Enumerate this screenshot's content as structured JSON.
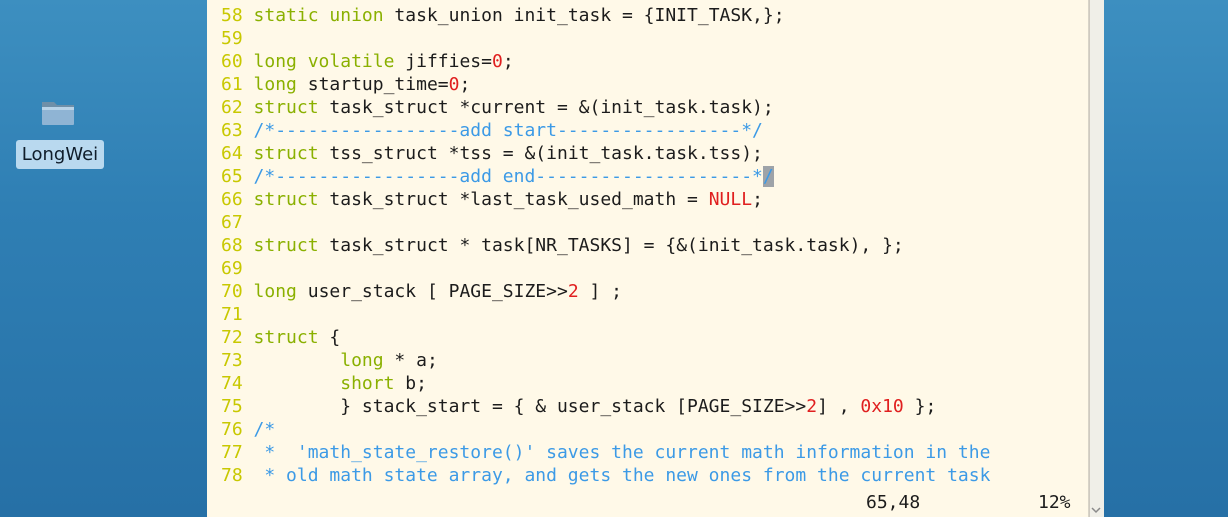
{
  "desktop": {
    "icon_name": "folder-icon",
    "label": "LongWei"
  },
  "editor": {
    "colors": {
      "background": "#fff9e8",
      "line_number": "#c8c800",
      "keyword": "#8ab000",
      "number": "#e01f1f",
      "comment": "#3c9ae6"
    },
    "lines": [
      {
        "n": "58",
        "t": [
          [
            "kw",
            "static union"
          ],
          [
            "",
            "task_union init_task = {INIT_TASK,};"
          ]
        ]
      },
      {
        "n": "59",
        "t": []
      },
      {
        "n": "60",
        "t": [
          [
            "kw",
            "long volatile"
          ],
          [
            "",
            "jiffies="
          ],
          [
            "num",
            "0"
          ],
          [
            "",
            ";"
          ]
        ]
      },
      {
        "n": "61",
        "t": [
          [
            "kw",
            "long"
          ],
          [
            "",
            "startup_time="
          ],
          [
            "num",
            "0"
          ],
          [
            "",
            ";"
          ]
        ]
      },
      {
        "n": "62",
        "t": [
          [
            "kw",
            "struct"
          ],
          [
            "",
            "task_struct *current = &(init_task.task);"
          ]
        ]
      },
      {
        "n": "63",
        "t": [
          [
            "cmt",
            "/*-----------------add start-----------------*/"
          ]
        ]
      },
      {
        "n": "64",
        "t": [
          [
            "kw",
            "struct"
          ],
          [
            "",
            "tss_struct *tss = &(init_task.task.tss);"
          ]
        ]
      },
      {
        "n": "65",
        "t": [
          [
            "cmt",
            "/*-----------------add end--------------------*"
          ],
          [
            "cursor",
            "/"
          ]
        ]
      },
      {
        "n": "66",
        "t": [
          [
            "kw",
            "struct"
          ],
          [
            "",
            "task_struct *last_task_used_math = "
          ],
          [
            "num",
            "NULL"
          ],
          [
            "",
            ";"
          ]
        ]
      },
      {
        "n": "67",
        "t": []
      },
      {
        "n": "68",
        "t": [
          [
            "kw",
            "struct"
          ],
          [
            "",
            "task_struct * task[NR_TASKS] = {&(init_task.task), };"
          ]
        ]
      },
      {
        "n": "69",
        "t": []
      },
      {
        "n": "70",
        "t": [
          [
            "kw",
            "long"
          ],
          [
            "",
            "user_stack [ PAGE_SIZE>>"
          ],
          [
            "num",
            "2"
          ],
          [
            "",
            " ] ;"
          ]
        ]
      },
      {
        "n": "71",
        "t": []
      },
      {
        "n": "72",
        "t": [
          [
            "kw",
            "struct"
          ],
          [
            "",
            " {"
          ]
        ]
      },
      {
        "n": "73",
        "t": [
          [
            "",
            "        "
          ],
          [
            "kw",
            "long"
          ],
          [
            "",
            " * a;"
          ]
        ]
      },
      {
        "n": "74",
        "t": [
          [
            "",
            "        "
          ],
          [
            "kw",
            "short"
          ],
          [
            "",
            " b;"
          ]
        ]
      },
      {
        "n": "75",
        "t": [
          [
            "",
            "        } stack_start = { & user_stack [PAGE_SIZE>>"
          ],
          [
            "num",
            "2"
          ],
          [
            "",
            "] , "
          ],
          [
            "num",
            "0x10"
          ],
          [
            "",
            " };"
          ]
        ]
      },
      {
        "n": "76",
        "t": [
          [
            "cmt",
            "/*"
          ]
        ]
      },
      {
        "n": "77",
        "t": [
          [
            "cmt",
            " *  'math_state_restore()' saves the current math information in the"
          ]
        ]
      },
      {
        "n": "78",
        "t": [
          [
            "cmt",
            " * old math state array, and gets the new ones from the current task"
          ]
        ]
      }
    ],
    "status": {
      "cursor_position": "65,48",
      "scroll_percent": "12%"
    }
  }
}
